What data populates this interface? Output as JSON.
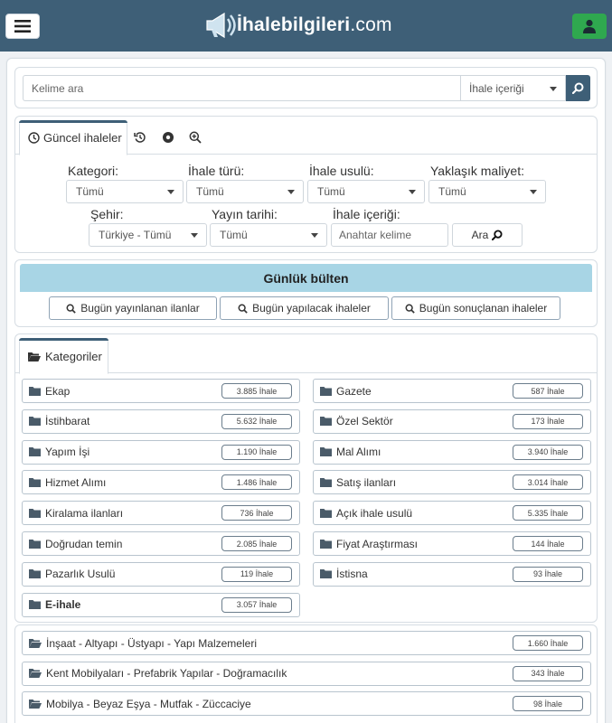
{
  "header": {
    "logo_main": "İhalebilgileri",
    "logo_suffix": ".com",
    "colors": {
      "bar": "#3e5f77",
      "user_button": "#2fa84f"
    },
    "icons": {
      "menu": "hamburger-icon",
      "logo": "megaphone-icon",
      "user": "user-icon"
    }
  },
  "search": {
    "placeholder": "Kelime ara",
    "scope_selected": "İhale içeriği",
    "icon": "search-icon"
  },
  "filters": {
    "active_tab": "Güncel ihaleler",
    "tab_icons": [
      "clock-icon",
      "history-icon",
      "record-icon",
      "zoom-in-icon"
    ],
    "row1": [
      {
        "label": "Kategori:",
        "value": "Tümü"
      },
      {
        "label": "İhale türü:",
        "value": "Tümü"
      },
      {
        "label": "İhale usulü:",
        "value": "Tümü"
      },
      {
        "label": "Yaklaşık maliyet:",
        "value": "Tümü"
      }
    ],
    "row2": [
      {
        "label": "Şehir:",
        "value": "Türkiye - Tümü"
      },
      {
        "label": "Yayın tarihi:",
        "value": "Tümü"
      },
      {
        "label": "İhale içeriği:",
        "placeholder": "Anahtar kelime"
      }
    ],
    "search_button": "Ara"
  },
  "bulletin": {
    "title": "Günlük bülten",
    "buttons": [
      "Bugün yayınlanan ilanlar",
      "Bugün yapılacak ihaleler",
      "Bugün sonuçlanan ihaleler"
    ],
    "header_color": "#a8d5e5"
  },
  "categories": {
    "tab_label": "Kategoriler",
    "items": [
      {
        "label": "Ekap",
        "count": "3.885 İhale"
      },
      {
        "label": "Gazete",
        "count": "587 İhale"
      },
      {
        "label": "İstihbarat",
        "count": "5.632 İhale"
      },
      {
        "label": "Özel Sektör",
        "count": "173 İhale"
      },
      {
        "label": "Yapım İşi",
        "count": "1.190 İhale"
      },
      {
        "label": "Mal Alımı",
        "count": "3.940 İhale"
      },
      {
        "label": "Hizmet Alımı",
        "count": "1.486 İhale"
      },
      {
        "label": "Satış ilanları",
        "count": "3.014 İhale"
      },
      {
        "label": "Kiralama ilanları",
        "count": "736 İhale"
      },
      {
        "label": "Açık ihale usulü",
        "count": "5.335 İhale"
      },
      {
        "label": "Doğrudan temin",
        "count": "2.085 İhale"
      },
      {
        "label": "Fiyat Araştırması",
        "count": "144 İhale"
      },
      {
        "label": "Pazarlık Usulü",
        "count": "119 İhale"
      },
      {
        "label": "İstisna",
        "count": "93 İhale"
      },
      {
        "label": "E-ihale",
        "count": "3.057 İhale"
      }
    ],
    "sectors": [
      {
        "label": "İnşaat - Altyapı - Üstyapı - Yapı Malzemeleri",
        "count": "1.660 İhale"
      },
      {
        "label": "Kent Mobilyaları - Prefabrik Yapılar - Doğramacılık",
        "count": "343 İhale"
      },
      {
        "label": "Mobilya - Beyaz Eşya - Mutfak - Züccaciye",
        "count": "98 İhale"
      }
    ]
  }
}
